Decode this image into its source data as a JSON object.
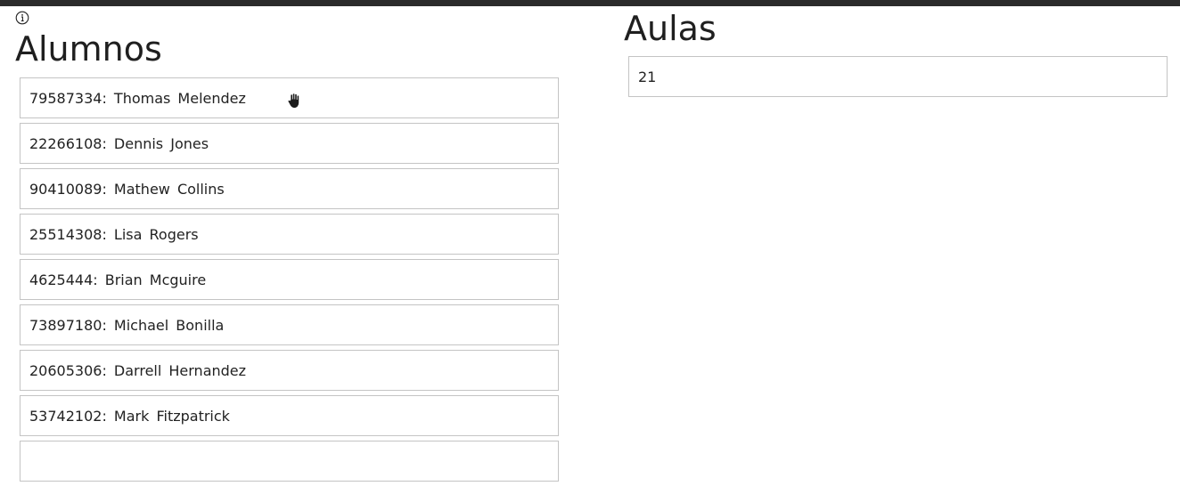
{
  "alumnos": {
    "title": "Alumnos",
    "items": [
      {
        "label": "79587334:  Thomas  Melendez"
      },
      {
        "label": "22266108:  Dennis  Jones"
      },
      {
        "label": "90410089:  Mathew  Collins"
      },
      {
        "label": "25514308:  Lisa  Rogers"
      },
      {
        "label": "4625444:  Brian  Mcguire"
      },
      {
        "label": "73897180:  Michael  Bonilla"
      },
      {
        "label": "20605306:  Darrell  Hernandez"
      },
      {
        "label": "53742102:  Mark  Fitzpatrick"
      },
      {
        "label": ""
      }
    ]
  },
  "aulas": {
    "title": "Aulas",
    "items": [
      {
        "label": "21"
      }
    ]
  },
  "icons": {
    "info": "info-icon",
    "cursor": "hand-cursor-icon"
  }
}
